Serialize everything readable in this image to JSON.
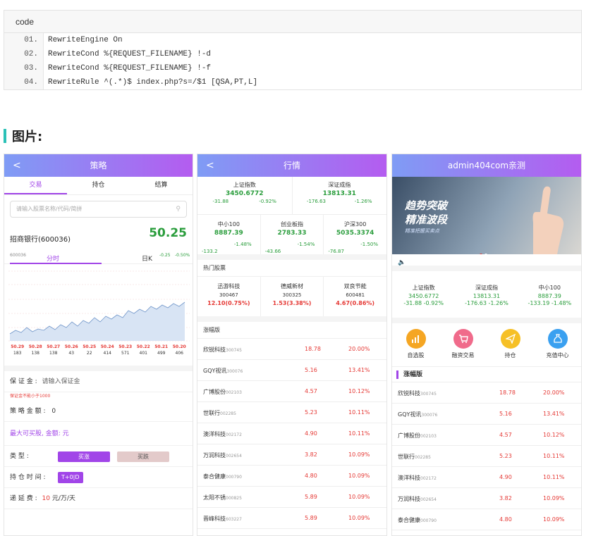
{
  "code_block": {
    "header": "code",
    "lines": [
      {
        "num": "01.",
        "text": "RewriteEngine On"
      },
      {
        "num": "02.",
        "text": "RewriteCond %{REQUEST_FILENAME} !-d"
      },
      {
        "num": "03.",
        "text": "RewriteCond %{REQUEST_FILENAME} !-f"
      },
      {
        "num": "04.",
        "text": "RewriteRule ^(.*)$ index.php?s=/$1 [QSA,PT,L]"
      }
    ]
  },
  "section_title": "图片:",
  "panel1": {
    "title": "策略",
    "back": "<",
    "tabs": [
      "交易",
      "持仓",
      "结算"
    ],
    "search_placeholder": "请输入股票名称/代码/简拼",
    "stock_name": "招商银行(600036)",
    "stock_price": "50.25",
    "stock_code_small": "600036",
    "chart_tab_fs": "分时",
    "chart_tab_dk": "日K",
    "chg_small_1": "-0.25",
    "chg_small_2": "-0.50%",
    "bottom_prices": [
      "50.29",
      "50.28",
      "50.27",
      "50.26",
      "50.25",
      "50.24",
      "50.23",
      "50.22",
      "50.21",
      "50.20"
    ],
    "bottom_vols": [
      "183",
      "138",
      "138",
      "43",
      "22",
      "414",
      "571",
      "401",
      "499",
      "406"
    ],
    "bond_label": "保 证 金 :",
    "bond_placeholder": "请输入保证金",
    "bond_hint": "保证金不能小于1000",
    "amount_label": "策 略 金 额 :",
    "amount_value": "0",
    "max_buy": "最大可买股, 金额: 元",
    "type_label": "类   型   :",
    "btn_buy": "买涨",
    "btn_sell": "买跌",
    "hold_label": "持 仓 时 间 :",
    "btn_t0": "T+0|D",
    "fee_label": "递 延 费 :",
    "fee_value": "10",
    "fee_unit": "元/万/天"
  },
  "panel2": {
    "title": "行情",
    "back": "<",
    "top_indices": [
      {
        "name": "上证指数",
        "value": "3450.6772",
        "chg": "-31.88",
        "pct": "-0.92%"
      },
      {
        "name": "深证成指",
        "value": "13813.31",
        "chg": "-176.63",
        "pct": "-1.26%"
      }
    ],
    "mid_indices": [
      {
        "name": "中小100",
        "value": "8887.39",
        "pct": "-1.48%",
        "chg": "-133.2"
      },
      {
        "name": "创业板指",
        "value": "2783.33",
        "pct": "-1.54%",
        "chg": "-43.66"
      },
      {
        "name": "沪深300",
        "value": "5035.3374",
        "pct": "-1.50%",
        "chg": "-76.87"
      }
    ],
    "hot_title": "热门股票",
    "hot": [
      {
        "name": "迅游科技",
        "code": "300467",
        "price": "12.10(0.75%)"
      },
      {
        "name": "德威新材",
        "code": "300325",
        "price": "1.53(3.38%)"
      },
      {
        "name": "双良节能",
        "code": "600481",
        "price": "4.67(0.86%)"
      }
    ],
    "rise_title": "涨幅版",
    "rise": [
      {
        "name": "欣锐科技",
        "code": "300745",
        "price": "18.78",
        "pct": "20.00%"
      },
      {
        "name": "GQY视讯",
        "code": "300076",
        "price": "5.16",
        "pct": "13.41%"
      },
      {
        "name": "广博股份",
        "code": "002103",
        "price": "4.57",
        "pct": "10.12%"
      },
      {
        "name": "世联行",
        "code": "002285",
        "price": "5.23",
        "pct": "10.11%"
      },
      {
        "name": "澳洋科技",
        "code": "002172",
        "price": "4.90",
        "pct": "10.11%"
      },
      {
        "name": "万润科技",
        "code": "002654",
        "price": "3.82",
        "pct": "10.09%"
      },
      {
        "name": "泰合健康",
        "code": "000790",
        "price": "4.80",
        "pct": "10.09%"
      },
      {
        "name": "太阳不锈",
        "code": "000825",
        "price": "5.89",
        "pct": "10.09%"
      },
      {
        "name": "晋峰科技",
        "code": "603227",
        "price": "5.89",
        "pct": "10.09%"
      }
    ]
  },
  "panel3": {
    "title": "admin404com亲测",
    "banner_line1": "趋势突破",
    "banner_line2": "精准波段",
    "banner_line3": "精准把握买卖点",
    "notice_icon": "speaker-icon",
    "indices": [
      {
        "name": "上证指数",
        "value": "3450.6772",
        "chg": "-31.88",
        "pct": "-0.92%"
      },
      {
        "name": "深证成指",
        "value": "13813.31",
        "chg": "-176.63",
        "pct": "-1.26%"
      },
      {
        "name": "中小100",
        "value": "8887.39",
        "chg": "-133.19",
        "pct": "-1.48%"
      }
    ],
    "icons": [
      {
        "label": "自选股",
        "color": "#f5a623"
      },
      {
        "label": "融资交易",
        "color": "#f06b8b"
      },
      {
        "label": "持仓",
        "color": "#f6c026"
      },
      {
        "label": "充值中心",
        "color": "#3aa0f0"
      }
    ],
    "rise_title": "涨幅版",
    "rise": [
      {
        "name": "欣锐科技",
        "code": "300745",
        "price": "18.78",
        "pct": "20.00%"
      },
      {
        "name": "GQY视讯",
        "code": "300076",
        "price": "5.16",
        "pct": "13.41%"
      },
      {
        "name": "广博股份",
        "code": "002103",
        "price": "4.57",
        "pct": "10.12%"
      },
      {
        "name": "世联行",
        "code": "002285",
        "price": "5.23",
        "pct": "10.11%"
      },
      {
        "name": "澳洋科技",
        "code": "002172",
        "price": "4.90",
        "pct": "10.11%"
      },
      {
        "name": "万润科技",
        "code": "002654",
        "price": "3.82",
        "pct": "10.09%"
      },
      {
        "name": "泰合健康",
        "code": "000790",
        "price": "4.80",
        "pct": "10.09%"
      }
    ]
  },
  "colors": {
    "accent": "#a145e8",
    "up": "#e53935",
    "down": "#2a9d3c",
    "header_start": "#7f9cf5",
    "header_end": "#b45cf0"
  }
}
